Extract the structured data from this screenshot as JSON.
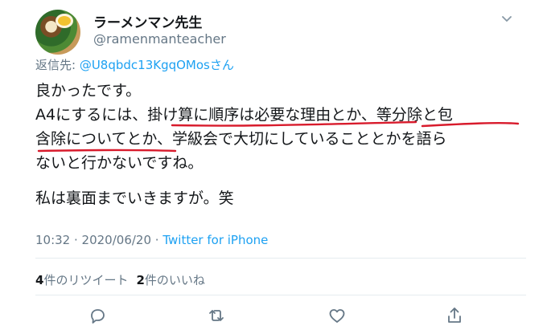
{
  "author": {
    "display_name": "ラーメンマン先生",
    "handle": "@ramenmanteacher"
  },
  "reply": {
    "prefix": "返信先: ",
    "mention": "@U8qbdc13KgqOMosさん"
  },
  "tweet": {
    "lines": [
      "良かったです。",
      "A4にするには、掛け算に順序は必要な理由とか、等分除と包",
      "含除についてとか、学級会で大切にしていることとかを語ら",
      "ないと行かないですね。",
      "私は裏面までいきますが。笑"
    ]
  },
  "meta": {
    "time": "10:32",
    "sep1": " · ",
    "date": "2020/06/20",
    "sep2": " · ",
    "source": "Twitter for iPhone"
  },
  "stats": {
    "retweets_count": "4",
    "retweets_label": "件のリツイート",
    "likes_count": "2",
    "likes_label": "件のいいね"
  },
  "colors": {
    "link": "#1da1f2",
    "muted": "#657786",
    "underline": "#d81b2c"
  },
  "icons": [
    "avatar-image",
    "chevron-down-icon",
    "reply-icon",
    "retweet-icon",
    "like-icon",
    "share-icon"
  ]
}
